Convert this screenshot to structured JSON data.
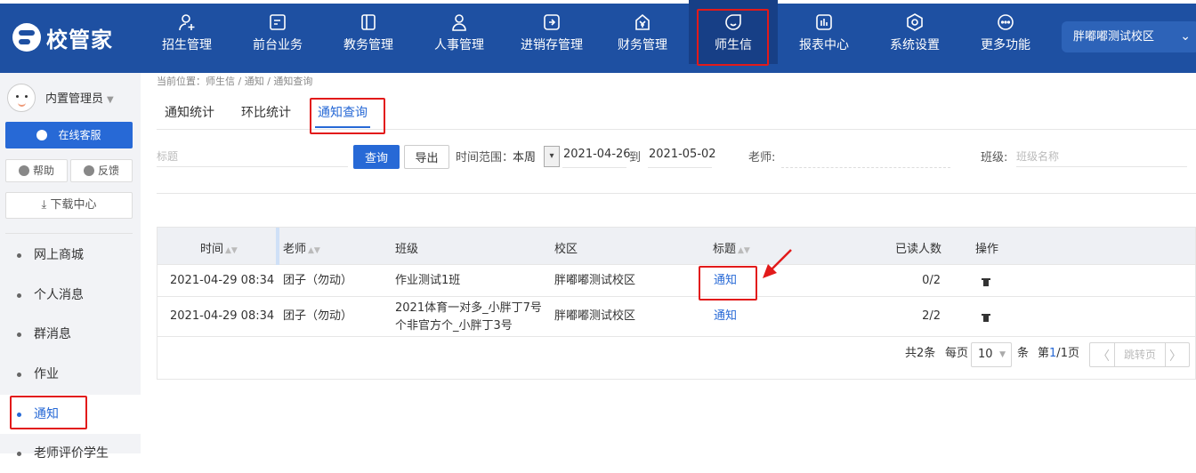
{
  "app": {
    "logo_text": "校管家",
    "campus": "胖嘟嘟测试校区"
  },
  "nav": [
    {
      "label": "招生管理",
      "icon": "user-add-icon"
    },
    {
      "label": "前台业务",
      "icon": "screen-icon"
    },
    {
      "label": "教务管理",
      "icon": "book-icon"
    },
    {
      "label": "人事管理",
      "icon": "person-icon"
    },
    {
      "label": "进销存管理",
      "icon": "inventory-icon"
    },
    {
      "label": "财务管理",
      "icon": "yen-icon"
    },
    {
      "label": "师生信",
      "icon": "chat-icon"
    },
    {
      "label": "报表中心",
      "icon": "report-icon"
    },
    {
      "label": "系统设置",
      "icon": "settings-icon"
    },
    {
      "label": "更多功能",
      "icon": "more-icon"
    }
  ],
  "sidebar": {
    "user_name": "内置管理员",
    "online_service": "在线客服",
    "help": "帮助",
    "feedback": "反馈",
    "download": "下载中心",
    "items": [
      "网上商城",
      "个人消息",
      "群消息",
      "作业",
      "通知",
      "老师评价学生"
    ]
  },
  "breadcrumb": "当前位置：师生信 / 通知 / 通知查询",
  "tabs": [
    "通知统计",
    "环比统计",
    "通知查询"
  ],
  "filter": {
    "title_placeholder": "标题",
    "query_label": "查询",
    "export_label": "导出",
    "time_range_label": "时间范围：",
    "range_value": "本周",
    "date_start": "2021-04-26",
    "to_label": "到",
    "date_end": "2021-05-02",
    "teacher_label": "老师:",
    "class_label": "班级:",
    "class_placeholder": "班级名称"
  },
  "table": {
    "headers": [
      "时间",
      "老师",
      "班级",
      "校区",
      "标题",
      "已读人数",
      "操作"
    ],
    "rows": [
      {
        "time": "2021-04-29 08:34",
        "teacher": "团子（勿动）",
        "class_line1": "作业测试1班",
        "class_line2": "",
        "campus": "胖嘟嘟测试校区",
        "title": "通知",
        "read": "0/2"
      },
      {
        "time": "2021-04-29 08:34",
        "teacher": "团子（勿动）",
        "class_line1": "2021体育一对多_小胖丁7号",
        "class_line2": "个非官方个_小胖丁3号",
        "campus": "胖嘟嘟测试校区",
        "title": "通知",
        "read": "2/2"
      }
    ]
  },
  "pager": {
    "total_prefix": "共",
    "total": "2",
    "total_suffix": "条",
    "per_page_label": "每页",
    "page_size": "10",
    "per_page_suffix": "条",
    "page_prefix": "第",
    "page_current": "1",
    "page_sep": "/",
    "page_total": "1",
    "page_suffix": "页",
    "jump_label": "跳转页"
  },
  "colors": {
    "primary": "#2769d6",
    "topbar": "#1e50a2",
    "highlight": "#e21a1a"
  }
}
